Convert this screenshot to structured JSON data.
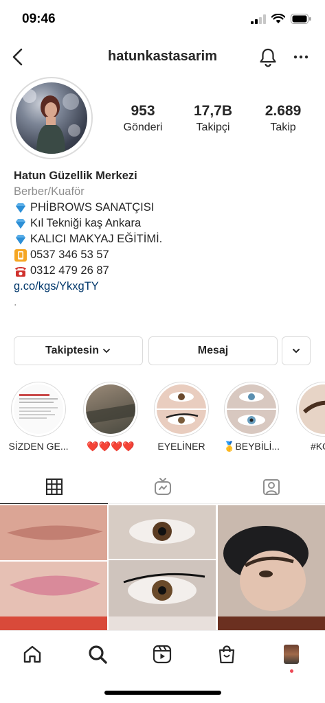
{
  "status_bar": {
    "time": "09:46"
  },
  "header": {
    "username": "hatunkastasarim",
    "icons": [
      "back-icon",
      "bell-icon",
      "more-icon"
    ]
  },
  "stats": [
    {
      "value": "953",
      "label": "Gönderi"
    },
    {
      "value": "17,7B",
      "label": "Takipçi"
    },
    {
      "value": "2.689",
      "label": "Takip"
    }
  ],
  "bio": {
    "name": "Hatun Güzellik Merkezi",
    "category": "Berber/Kuaför",
    "lines": [
      {
        "emoji": "gem-icon",
        "text": "PHİBROWS SANATÇISI"
      },
      {
        "emoji": "gem-icon",
        "text": "Kıl Tekniği kaş Ankara"
      },
      {
        "emoji": "gem-icon",
        "text": "KALICI MAKYAJ EĞİTİMİ."
      },
      {
        "emoji": "phone-icon",
        "text": "0537 346 53 57"
      },
      {
        "emoji": "telephone-icon",
        "text": "0312 479 26 87"
      }
    ],
    "link": "g.co/kgs/YkxgTY",
    "extra": "."
  },
  "actions": {
    "following": "Takiptesin",
    "message": "Mesaj"
  },
  "highlights": [
    {
      "label": "SİZDEN GE..."
    },
    {
      "label": "❤️❤️❤️❤️"
    },
    {
      "label": "EYELİNER"
    },
    {
      "label": "🥇BEYBİLİ..."
    },
    {
      "label": "#KOÇ"
    }
  ],
  "tabs": [
    "grid-icon",
    "igtv-icon",
    "tagged-icon"
  ],
  "bottom_nav": [
    "home-icon",
    "search-icon",
    "reels-icon",
    "shop-icon",
    "profile-avatar"
  ],
  "colors": {
    "text": "#262626",
    "secondary": "#8e8e8e",
    "link": "#00376b",
    "border": "#dbdbdb"
  }
}
